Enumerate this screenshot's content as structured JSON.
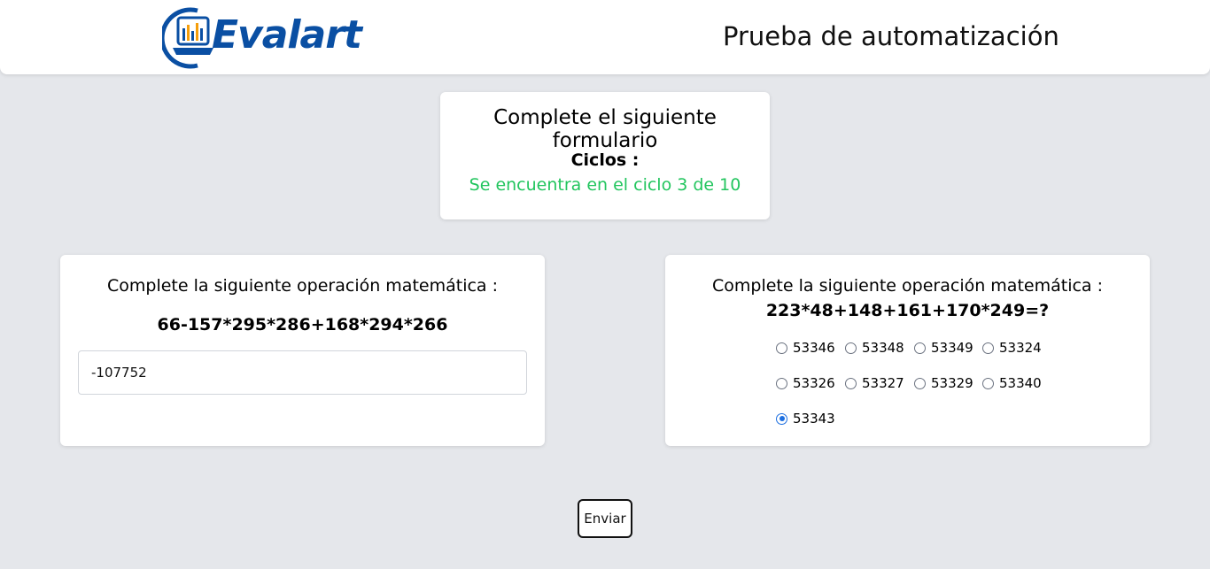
{
  "header": {
    "logo_text": "Evalart",
    "title": "Prueba de automatización"
  },
  "colors": {
    "brand_blue": "#0a4fa3",
    "logo_orange": "#f59e0b",
    "status_green": "#22c55e",
    "radio_selected": "#1d6fe0",
    "background": "#e5e7eb"
  },
  "intro_card": {
    "title": "Complete el siguiente formulario",
    "cycles_label": "Ciclos :",
    "cycles_status": "Se encuentra en el ciclo 3 de 10"
  },
  "question_input": {
    "label": "Complete la siguiente operación matemática :",
    "expression": "66-157*295*286+168*294*266",
    "answer_value": "-107752"
  },
  "question_choice": {
    "label": "Complete la siguiente operación matemática :",
    "expression": "223*48+148+161+170*249=?",
    "options": [
      "53346",
      "53348",
      "53349",
      "53324",
      "53326",
      "53327",
      "53329",
      "53340",
      "53343"
    ],
    "selected": "53343"
  },
  "submit": {
    "label": "Enviar"
  },
  "icons": {
    "logo": "evalart-laptop-chart-icon"
  }
}
